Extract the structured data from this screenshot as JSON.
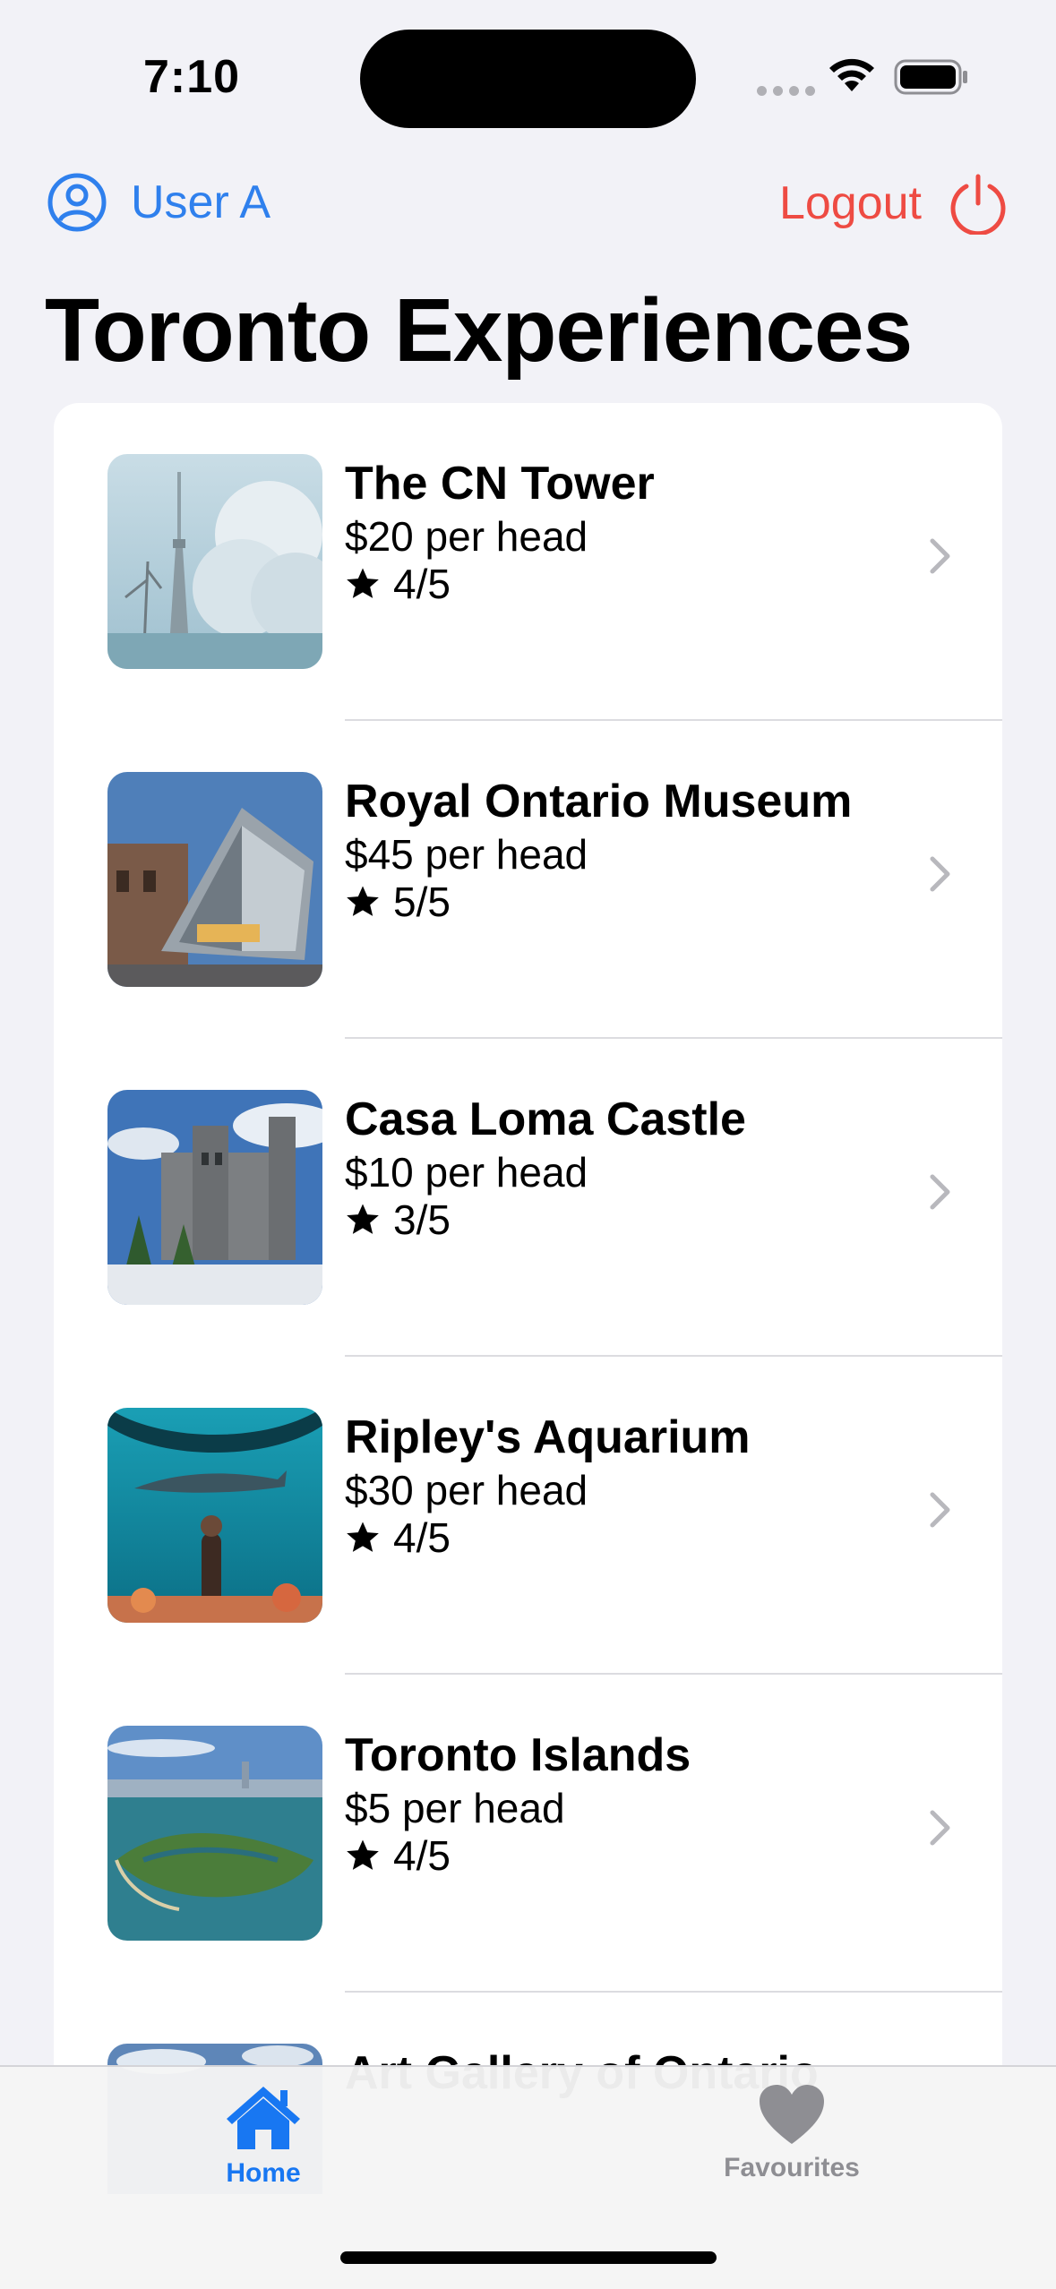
{
  "status_bar": {
    "time": "7:10"
  },
  "nav": {
    "user_label": "User A",
    "logout_label": "Logout"
  },
  "page": {
    "title": "Toronto Experiences"
  },
  "experiences": [
    {
      "title": "The CN Tower",
      "price": "$20 per head",
      "rating": "4/5"
    },
    {
      "title": "Royal Ontario Museum",
      "price": "$45 per head",
      "rating": "5/5"
    },
    {
      "title": "Casa Loma Castle",
      "price": "$10 per head",
      "rating": "3/5"
    },
    {
      "title": "Ripley's Aquarium",
      "price": "$30 per head",
      "rating": "4/5"
    },
    {
      "title": "Toronto Islands",
      "price": "$5 per head",
      "rating": "4/5"
    },
    {
      "title": "Art Gallery of Ontario",
      "price": "",
      "rating": ""
    }
  ],
  "tab_bar": {
    "home_label": "Home",
    "favourites_label": "Favourites",
    "active": "Home"
  },
  "colors": {
    "accent": "#1877f2",
    "link": "#2f80ed",
    "logout": "#ee4b43",
    "inactive": "#8e8e93",
    "background": "#f2f2f7"
  },
  "icons": [
    "person-circle-icon",
    "power-icon",
    "chevron-right-icon",
    "star-icon",
    "house-icon",
    "heart-icon",
    "wifi-icon",
    "battery-icon"
  ]
}
